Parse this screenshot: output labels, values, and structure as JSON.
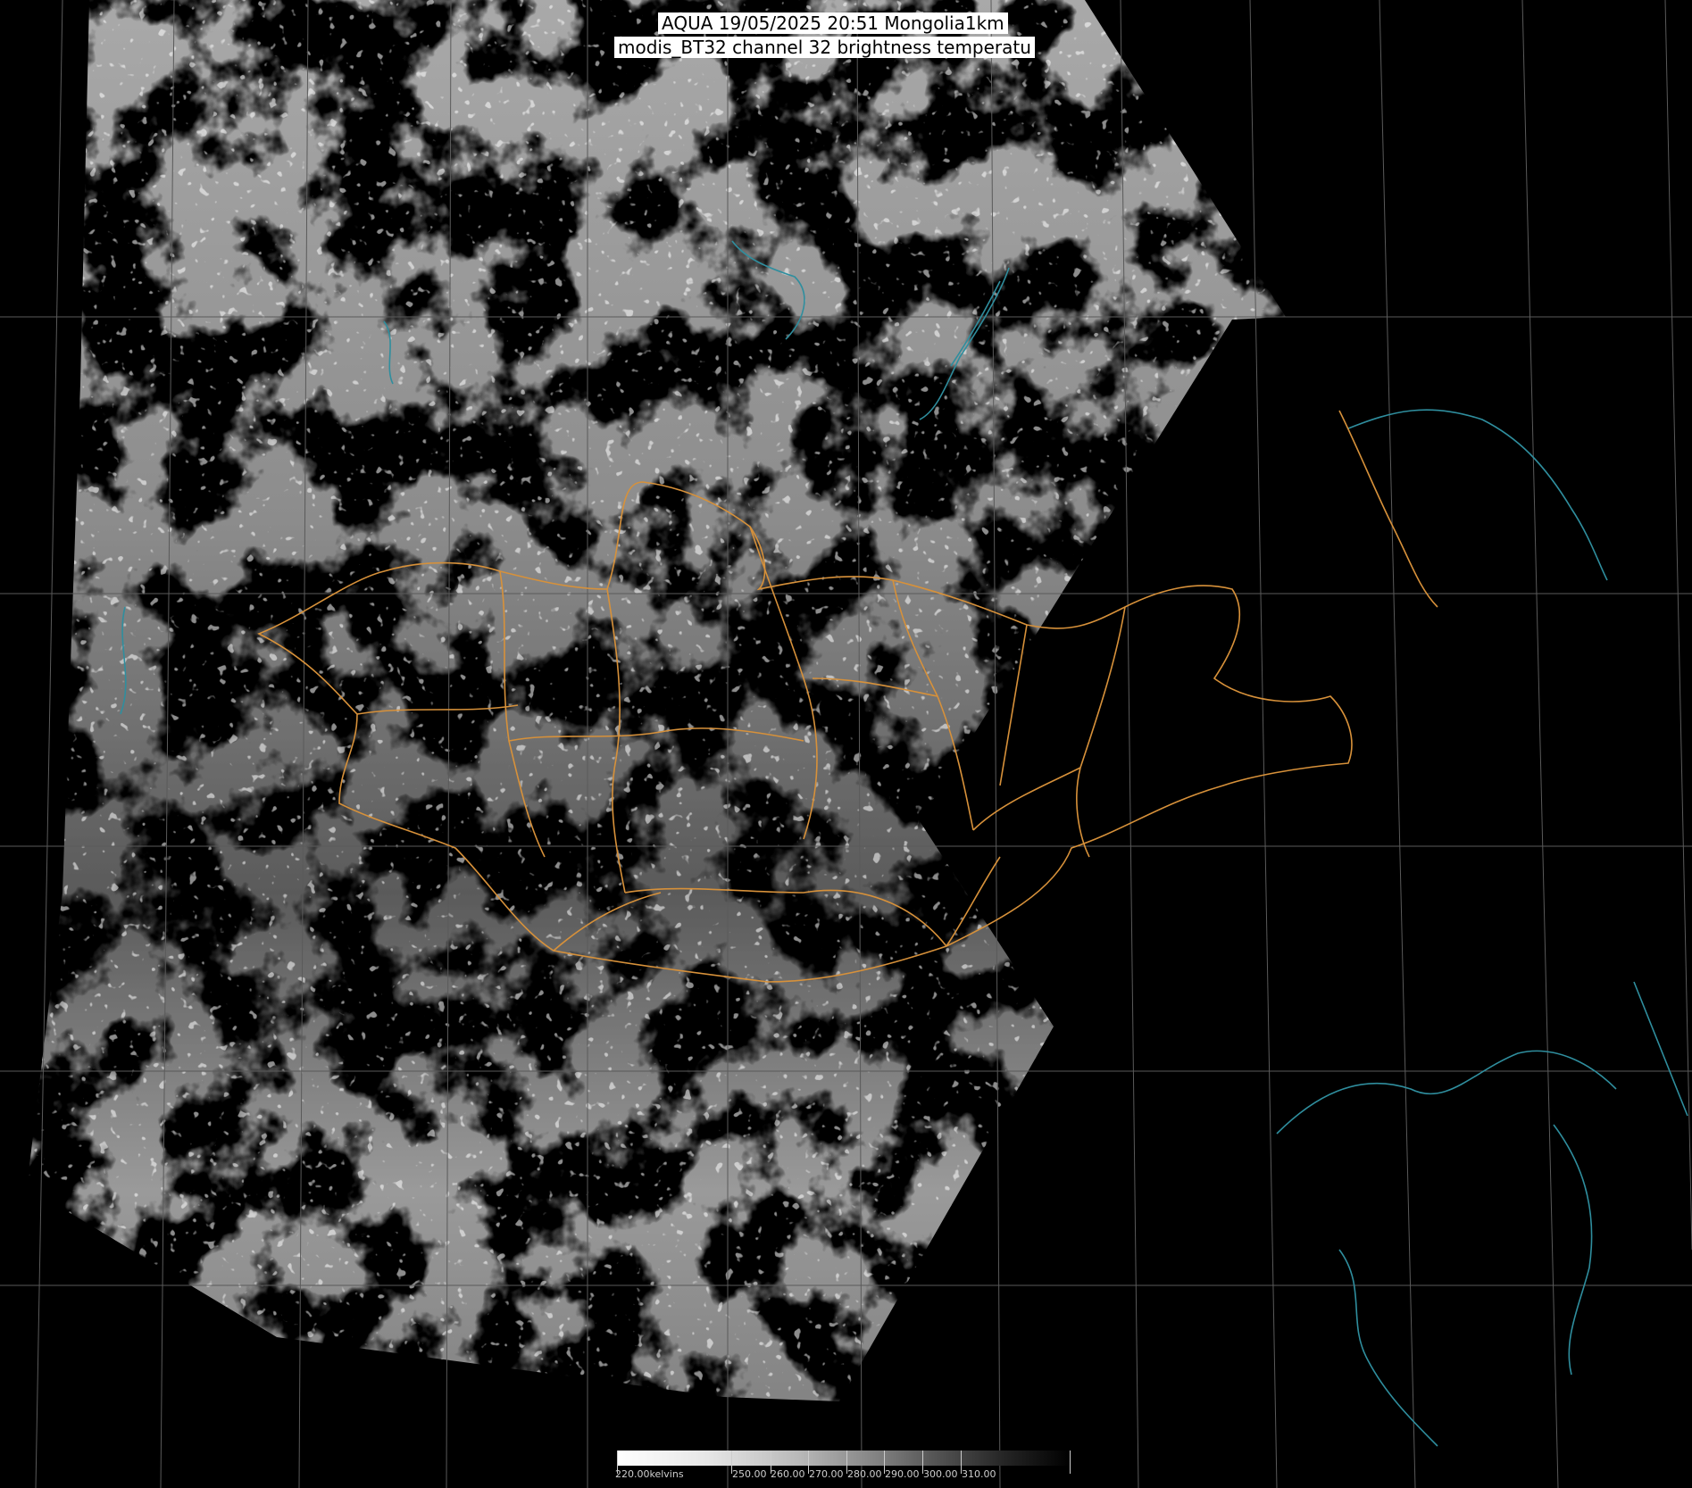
{
  "title": {
    "line1": "AQUA 19/05/2025 20:51 Mongolia1km",
    "line2": "modis_BT32 channel 32 brightness temperatu"
  },
  "colorbar": {
    "labels": [
      "220.00kelvins",
      "250.00",
      "260.00",
      "270.00",
      "280.00",
      "290.00",
      "300.00",
      "310.00"
    ]
  },
  "colors": {
    "background": "#000000",
    "grid": "#5a5a5a",
    "border": "#d7913a",
    "coast_water": "#2f8e9e"
  }
}
